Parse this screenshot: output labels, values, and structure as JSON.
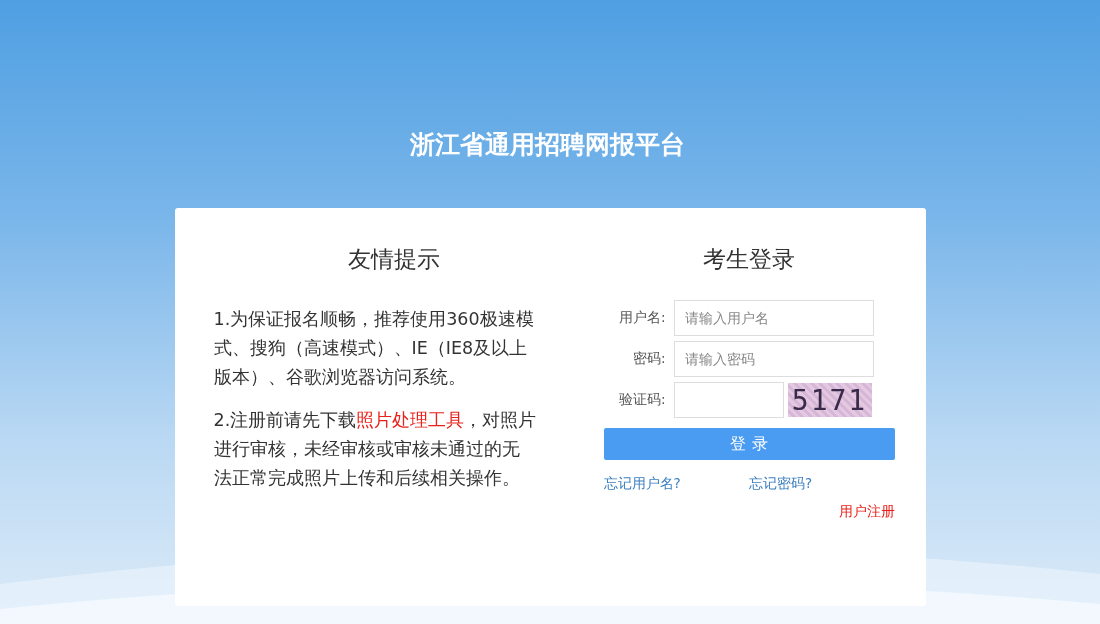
{
  "site_title": "浙江省通用招聘网报平台",
  "notice": {
    "title": "友情提示",
    "items": [
      {
        "before": "1.为保证报名顺畅，推荐使用360极速模式、搜狗（高速模式）、IE（IE8及以上版本）、谷歌浏览器访问系统。"
      },
      {
        "before": "2.注册前请先下载",
        "link": "照片处理工具",
        "after": "，对照片进行审核，未经审核或审核未通过的无法正常完成照片上传和后续相关操作。"
      }
    ]
  },
  "login": {
    "title": "考生登录",
    "fields": [
      {
        "kind": "text",
        "label": "用户名:",
        "placeholder": "请输入用户名"
      },
      {
        "kind": "password",
        "label": "密码:",
        "placeholder": "请输入密码"
      },
      {
        "kind": "captcha",
        "label": "验证码:",
        "captcha": "5171"
      }
    ],
    "submit": "登 录",
    "links": [
      "忘记用户名?",
      "忘记密码?"
    ],
    "register": "用户注册"
  }
}
